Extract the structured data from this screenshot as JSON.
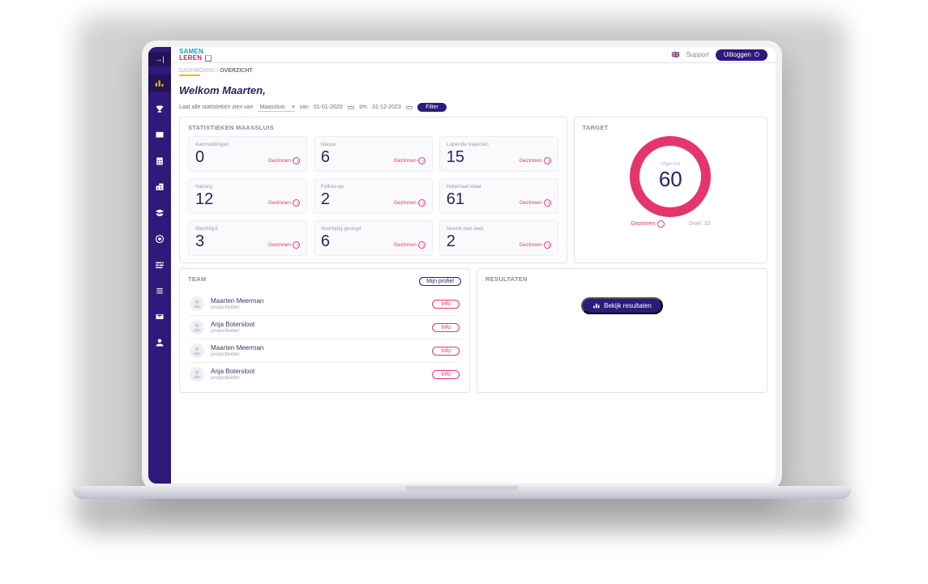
{
  "app": {
    "logo_line1": "SAMEN",
    "logo_line2": "LEREN",
    "support_label": "Support",
    "logout_label": "Uitloggen",
    "lang_flag": "🇬🇧"
  },
  "breadcrumb": {
    "root": "DASHBOARD",
    "sep": "/",
    "current": "OVERZICHT"
  },
  "welcome": "Welkom Maarten,",
  "filter_bar": {
    "intro": "Laat alle statistieken zien van",
    "location": "Maassluis",
    "from_label": "van",
    "from_value": "01-01-2020",
    "to_label": "t/m",
    "to_value": "31-12-2023",
    "button": "Filter"
  },
  "panels": {
    "stats_title": "STATISTIEKEN MAASSLUIS",
    "target_title": "TARGET",
    "team_title": "TEAM",
    "results_title": "RESULTATEN",
    "my_profile_btn": "Mijn profiel",
    "view_results_btn": "Bekijk resultaten"
  },
  "stat_link_label": "Gezinnen",
  "stats": [
    {
      "label": "Aanmeldingen",
      "value": "0"
    },
    {
      "label": "Nieuw",
      "value": "6"
    },
    {
      "label": "Lopende trajecten",
      "value": "15"
    },
    {
      "label": "Nazorg",
      "value": "12"
    },
    {
      "label": "Follow-up",
      "value": "2"
    },
    {
      "label": "Helemaal klaar",
      "value": "61"
    },
    {
      "label": "Wachtlijst",
      "value": "3"
    },
    {
      "label": "Voortijdig gestopt",
      "value": "6"
    },
    {
      "label": "Neemt niet deel",
      "value": "2"
    }
  ],
  "target": {
    "rounded_label": "Afgerond",
    "rounded_value": "60",
    "families_label": "Gezinnen",
    "goal_label": "Doel: 33"
  },
  "team": [
    {
      "name": "Maarten Meerman",
      "role": "projectleider"
    },
    {
      "name": "Anja Botersloot",
      "role": "projectleider"
    },
    {
      "name": "Maarten Meerman",
      "role": "projectleider"
    },
    {
      "name": "Anja Botersloot",
      "role": "projectleider"
    }
  ],
  "team_info_btn": "Info",
  "sidebar": {
    "items": [
      {
        "name": "dashboard-icon"
      },
      {
        "name": "trophy-icon"
      },
      {
        "name": "book-icon"
      },
      {
        "name": "building-icon"
      },
      {
        "name": "org-icon"
      },
      {
        "name": "grad-icon"
      },
      {
        "name": "target-icon"
      },
      {
        "name": "sliders-icon"
      },
      {
        "name": "list-icon"
      },
      {
        "name": "mail-icon"
      },
      {
        "name": "user-icon"
      }
    ]
  }
}
